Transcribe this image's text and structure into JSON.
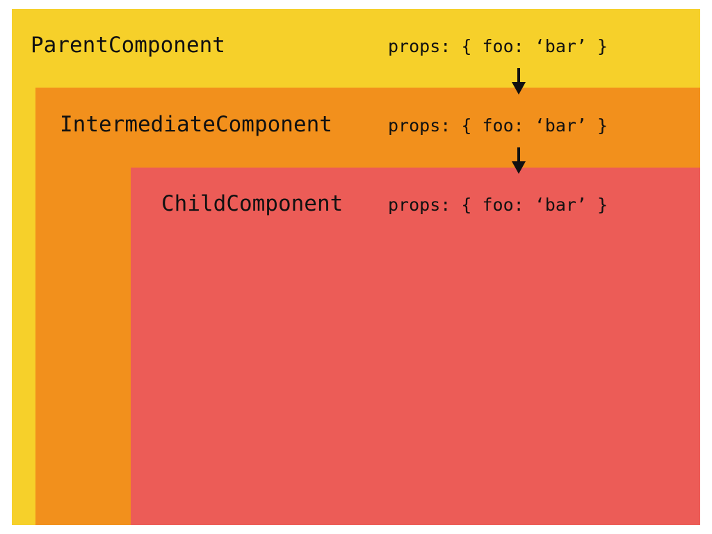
{
  "diagram": {
    "parent": {
      "name": "ParentComponent",
      "props": "props: { foo: ‘bar’ }",
      "color": "#f6d02a"
    },
    "intermediate": {
      "name": "IntermediateComponent",
      "props": "props: { foo: ‘bar’ }",
      "color": "#f2901c"
    },
    "child": {
      "name": "ChildComponent",
      "props": "props: { foo: ‘bar’ }",
      "color": "#ec5c57"
    },
    "arrow_icon": "arrow-down-icon"
  }
}
